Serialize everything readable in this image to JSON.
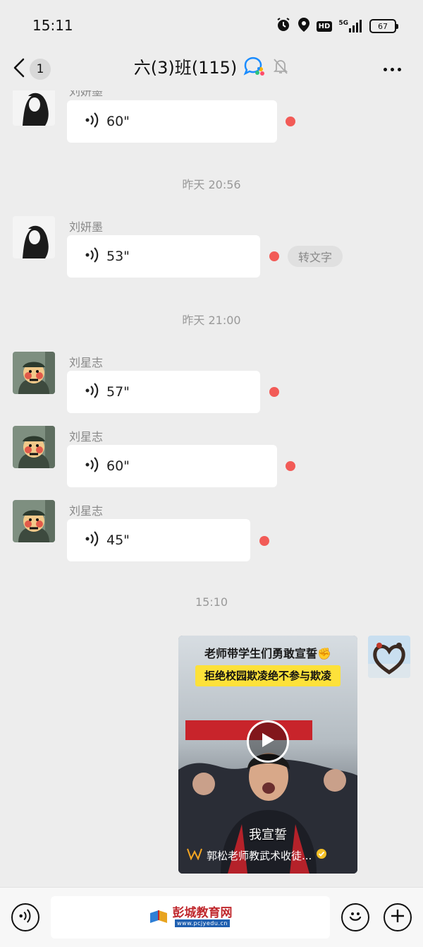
{
  "status_bar": {
    "time": "15:11",
    "network": "5G",
    "hd": "HD",
    "battery": "67"
  },
  "header": {
    "back_badge": "1",
    "title": "六(3)班(115)"
  },
  "messages": [
    {
      "sender": "刘妍墨",
      "duration": "60\""
    },
    {
      "sender": "刘妍墨",
      "duration": "53\"",
      "action": "转文字"
    },
    {
      "sender": "刘星志",
      "duration": "57\""
    },
    {
      "sender": "刘星志",
      "duration": "60\""
    },
    {
      "sender": "刘星志",
      "duration": "45\""
    }
  ],
  "timestamps": [
    "昨天 20:56",
    "昨天 21:00",
    "15:10"
  ],
  "video": {
    "headline": "老师带学生们勇敢宣誓✊",
    "subheadline": "拒绝校园欺凌绝不参与欺凌",
    "caption": "我宣誓",
    "channel": "郭松老师教武术收徒..."
  },
  "input_bar": {
    "watermark_name": "彭城教育网",
    "watermark_url": "www.pcjyedu.cn"
  },
  "colors": {
    "unread_dot": "#f25b57",
    "background": "#ededed",
    "bubble": "#ffffff"
  }
}
